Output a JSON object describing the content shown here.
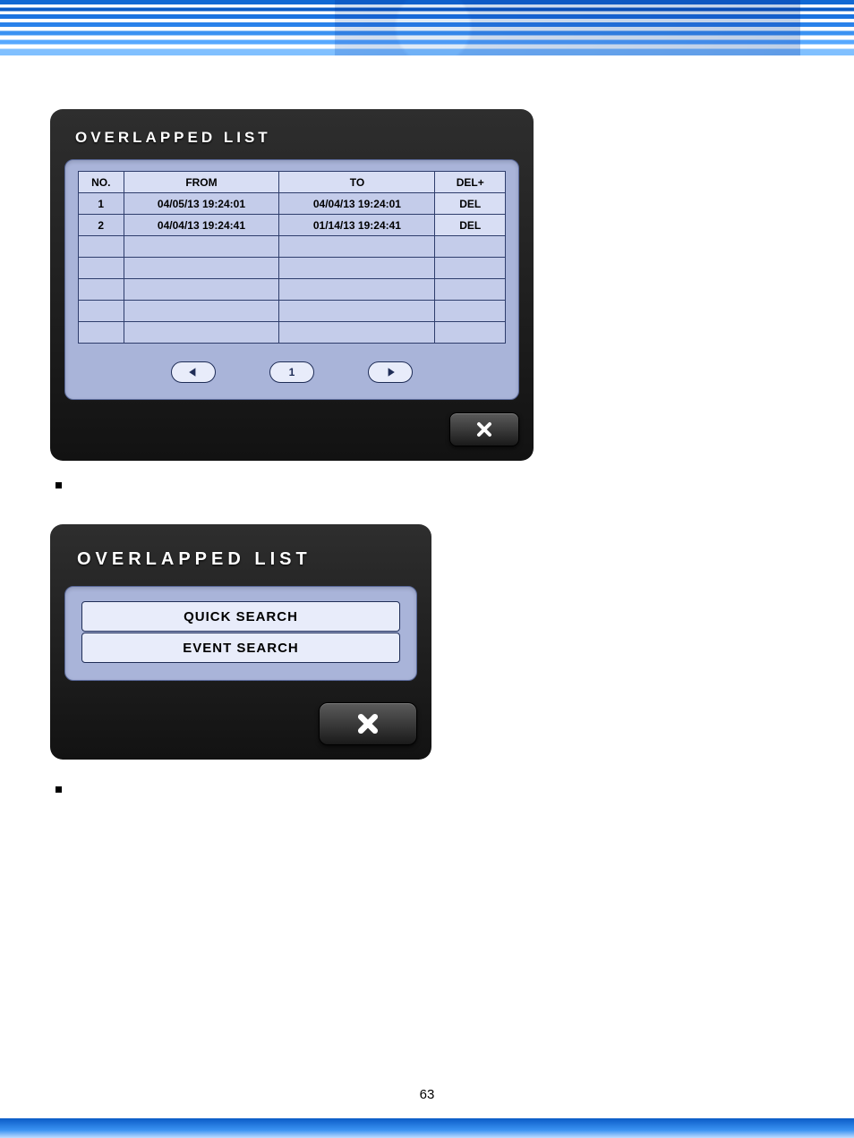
{
  "page_number": "63",
  "panel1": {
    "title": "OVERLAPPED LIST",
    "headers": {
      "no": "NO.",
      "from": "FROM",
      "to": "TO",
      "del": "DEL+"
    },
    "rows": [
      {
        "no": "1",
        "from": "04/05/13  19:24:01",
        "to": "04/04/13  19:24:01",
        "del": "DEL"
      },
      {
        "no": "2",
        "from": "04/04/13  19:24:41",
        "to": "01/14/13  19:24:41",
        "del": "DEL"
      },
      {
        "no": "",
        "from": "",
        "to": "",
        "del": ""
      },
      {
        "no": "",
        "from": "",
        "to": "",
        "del": ""
      },
      {
        "no": "",
        "from": "",
        "to": "",
        "del": ""
      },
      {
        "no": "",
        "from": "",
        "to": "",
        "del": ""
      },
      {
        "no": "",
        "from": "",
        "to": "",
        "del": ""
      }
    ],
    "pager_current": "1"
  },
  "panel2": {
    "title": "OVERLAPPED LIST",
    "quick_search": "QUICK SEARCH",
    "event_search": "EVENT SEARCH"
  }
}
